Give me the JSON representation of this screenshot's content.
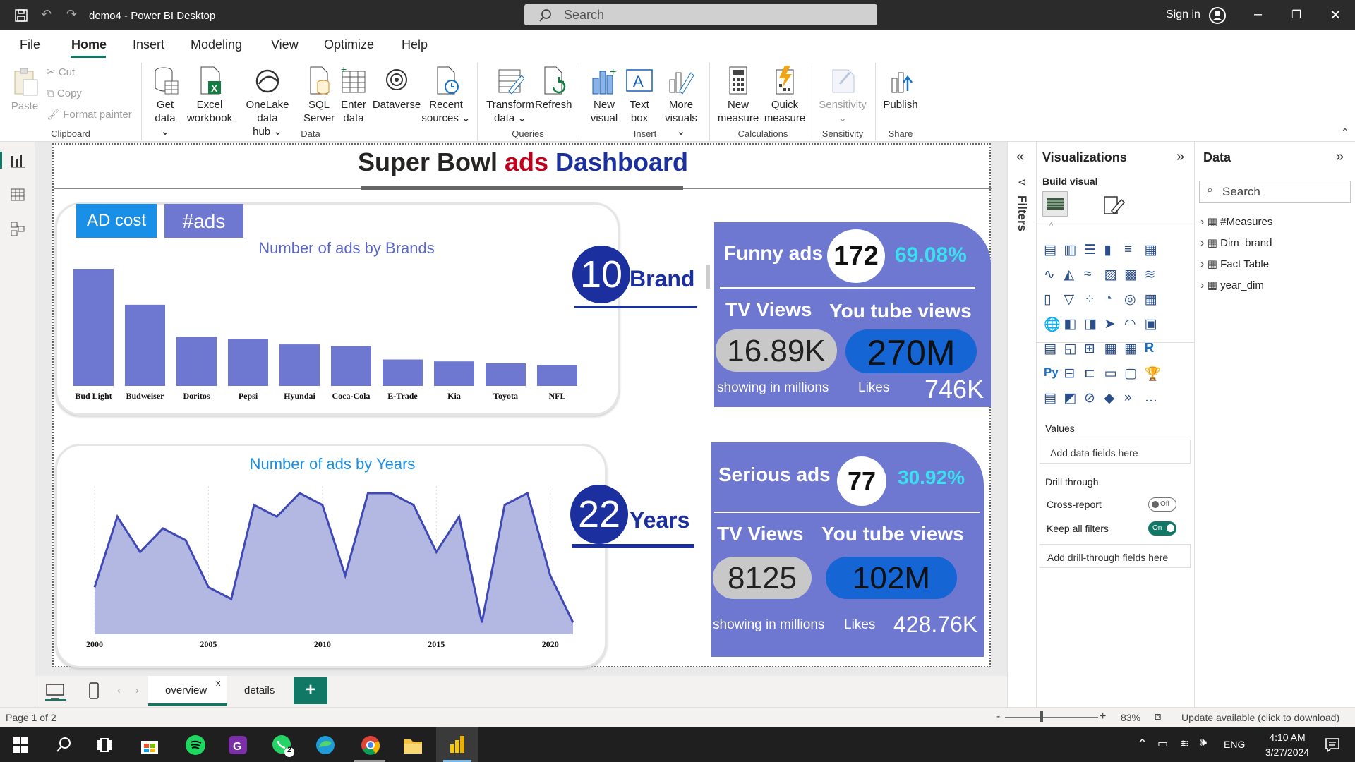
{
  "window": {
    "title": "demo4 - Power BI Desktop",
    "search_placeholder": "Search",
    "signin": "Sign in"
  },
  "menu": [
    "File",
    "Home",
    "Insert",
    "Modeling",
    "View",
    "Optimize",
    "Help"
  ],
  "ribbon": {
    "clipboard": {
      "paste": "Paste",
      "cut": "Cut",
      "copy": "Copy",
      "format_painter": "Format painter",
      "group": "Clipboard"
    },
    "data": {
      "get_data_1": "Get",
      "get_data_2": "data",
      "excel_1": "Excel",
      "excel_2": "workbook",
      "onelake_1": "OneLake data",
      "onelake_2": "hub",
      "sql_1": "SQL",
      "sql_2": "Server",
      "enter_1": "Enter",
      "enter_2": "data",
      "dataverse": "Dataverse",
      "recent_1": "Recent",
      "recent_2": "sources",
      "group": "Data"
    },
    "queries": {
      "transform_1": "Transform",
      "transform_2": "data",
      "refresh": "Refresh",
      "group": "Queries"
    },
    "insert": {
      "newvisual_1": "New",
      "newvisual_2": "visual",
      "textbox_1": "Text",
      "textbox_2": "box",
      "more_1": "More",
      "more_2": "visuals",
      "group": "Insert"
    },
    "calculations": {
      "newmeasure_1": "New",
      "newmeasure_2": "measure",
      "quick_1": "Quick",
      "quick_2": "measure",
      "group": "Calculations"
    },
    "sensitivity": {
      "label": "Sensitivity",
      "group": "Sensitivity"
    },
    "share": {
      "publish": "Publish",
      "group": "Share"
    }
  },
  "dashboard": {
    "title_part1": "Super Bowl ",
    "title_part2": "ads",
    "title_part3": " Dashboard",
    "btn_adcost": "AD cost",
    "btn_ads": "#ads",
    "brand_count": "10",
    "brand_label": "Brand",
    "years_count": "22",
    "years_label": "Years",
    "funny": {
      "label": "Funny ads",
      "count": "172",
      "pct": "69.08%",
      "tv_label": "TV Views",
      "yt_label": "You tube views",
      "tv_value": "16.89K",
      "yt_value": "270M",
      "note": "showing in millions",
      "likes_label": "Likes",
      "likes_value": "746K"
    },
    "serious": {
      "label": "Serious ads",
      "count": "77",
      "pct": "30.92%",
      "tv_label": "TV Views",
      "yt_label": "You tube views",
      "tv_value": "8125",
      "yt_value": "102M",
      "note": "showing in millions",
      "likes_label": "Likes",
      "likes_value": "428.76K"
    }
  },
  "chart_data": [
    {
      "type": "bar",
      "title": "Number of ads by Brands",
      "categories": [
        "Bud Light",
        "Budweiser",
        "Doritos",
        "Pepsi",
        "Hyundai",
        "Coca-Cola",
        "E-Trade",
        "Kia",
        "Toyota",
        "NFL"
      ],
      "values": [
        62,
        43,
        26,
        25,
        22,
        21,
        14,
        13,
        12,
        11
      ],
      "ylim": [
        0,
        62
      ],
      "color": "#6e78d0"
    },
    {
      "type": "area",
      "title": "Number of ads by Years",
      "x": [
        2000,
        2001,
        2002,
        2003,
        2004,
        2005,
        2006,
        2007,
        2008,
        2009,
        2010,
        2011,
        2012,
        2013,
        2014,
        2015,
        2016,
        2017,
        2018,
        2019,
        2020,
        2021
      ],
      "values": [
        4,
        10,
        7,
        9,
        8,
        4,
        3,
        11,
        10,
        12,
        11,
        5,
        12,
        12,
        11,
        7,
        10,
        1,
        11,
        12,
        5,
        1
      ],
      "xticks": [
        "2000",
        "2005",
        "2010",
        "2015",
        "2020"
      ],
      "ylim": [
        0,
        12
      ],
      "color": "#3f48b5",
      "fill": "#b3b8e3"
    }
  ],
  "viz_pane": {
    "title": "Visualizations",
    "build": "Build visual",
    "values": "Values",
    "add_data": "Add data fields here",
    "drill": "Drill through",
    "cross_report": "Cross-report",
    "cross_state": "Off",
    "keep_filters": "Keep all filters",
    "keep_state": "On",
    "add_drill": "Add drill-through fields here"
  },
  "filters_label": "Filters",
  "data_pane": {
    "title": "Data",
    "search": "Search",
    "tables": [
      "#Measures",
      "Dim_brand",
      "Fact Table",
      "year_dim"
    ]
  },
  "tabs": {
    "overview": "overview",
    "details": "details",
    "close": "x",
    "add": "+"
  },
  "status": {
    "page": "Page 1 of 2",
    "zoom": "83%",
    "update": "Update available (click to download)"
  },
  "taskbar": {
    "lang": "ENG",
    "time": "4:10 AM",
    "date": "3/27/2024",
    "whatsapp_badge": "2"
  },
  "colors": {
    "accent_blue": "#1b2f9e",
    "kpi_bg": "#6e78d0",
    "ads_red": "#c0001a",
    "title_bar": "#2b2b2b",
    "cyan": "#3ae0f0"
  }
}
